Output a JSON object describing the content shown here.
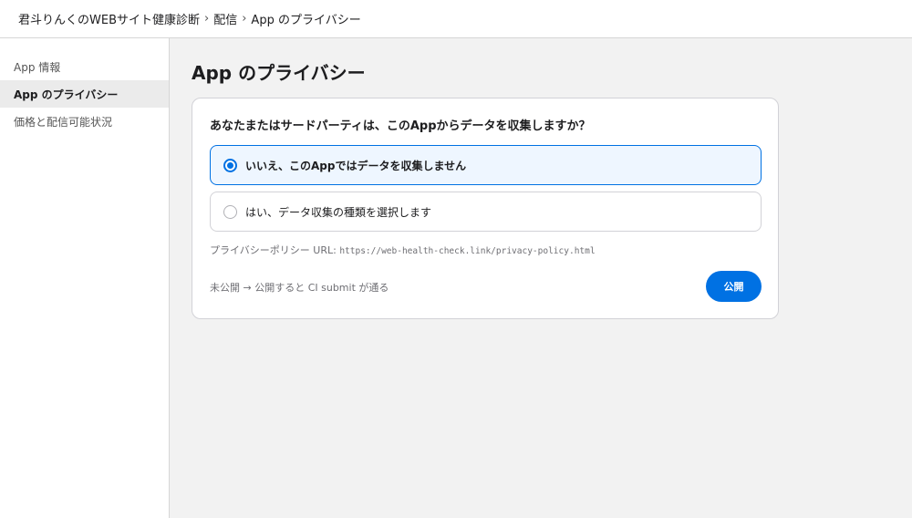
{
  "breadcrumb": {
    "app": "君斗りんくのWEBサイト健康診断",
    "section": "配信",
    "page": "App のプライバシー",
    "separator": "›"
  },
  "sidebar": {
    "items": [
      {
        "label": "App 情報",
        "active": false
      },
      {
        "label": "App のプライバシー",
        "active": true
      },
      {
        "label": "価格と配信可能状況",
        "active": false
      }
    ]
  },
  "main": {
    "title": "App のプライバシー",
    "question": "あなたまたはサードパーティは、このAppからデータを収集しますか？",
    "options": [
      {
        "label": "いいえ、このAppではデータを収集しません",
        "selected": true
      },
      {
        "label": "はい、データ収集の種類を選択します",
        "selected": false
      }
    ],
    "policy_label": "プライバシーポリシー URL: ",
    "policy_url": "https://web-health-check.link/privacy-policy.html",
    "status_text": "未公開 → 公開すると CI submit が通る",
    "publish_label": "公開"
  },
  "colors": {
    "accent": "#0071e3",
    "selected_bg": "#eef6ff",
    "page_bg": "#f2f2f2"
  }
}
